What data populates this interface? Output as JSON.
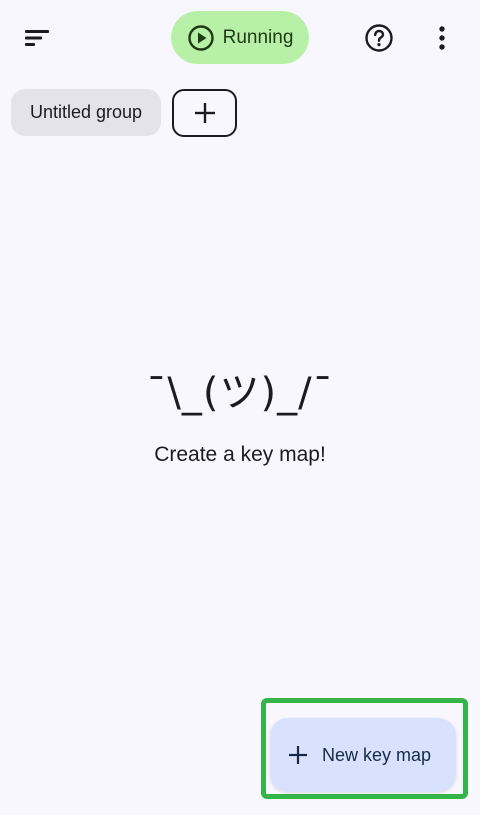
{
  "top_bar": {
    "sort_icon": "sort-icon",
    "status_chip": {
      "label": "Running",
      "icon": "play-circle-icon",
      "color": "#b9f0a8"
    },
    "help_icon": "help-circle-icon",
    "more_icon": "more-vert-icon"
  },
  "groups": {
    "items": [
      {
        "label": "Untitled group"
      }
    ],
    "add_icon": "add-icon"
  },
  "empty_state": {
    "emoticon": "¯\\_(ツ)_/¯",
    "message": "Create a key map!"
  },
  "fab": {
    "label": "New key map",
    "icon": "add-icon",
    "color": "#d9e2fc",
    "highlight_color": "#33b54a"
  }
}
